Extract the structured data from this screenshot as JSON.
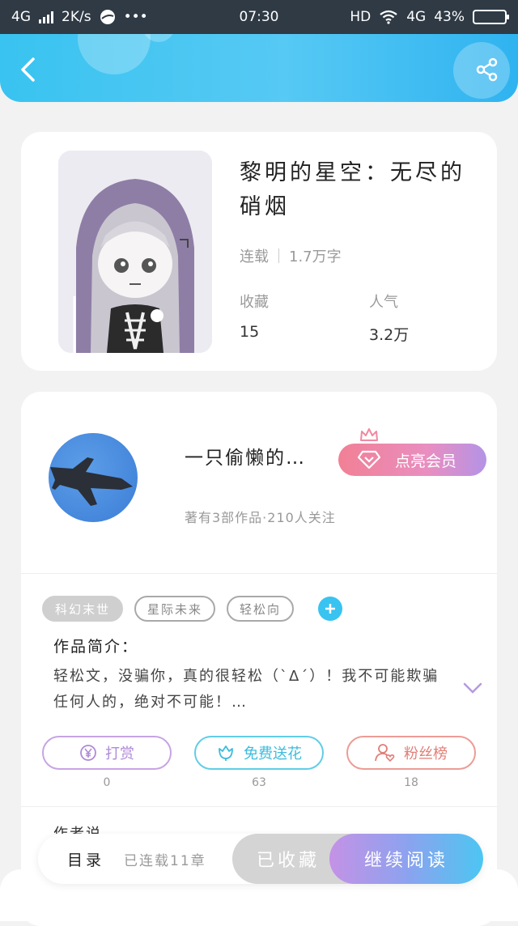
{
  "status_bar": {
    "network": "4G",
    "speed": "2K/s",
    "more": "•••",
    "time": "07:30",
    "hd": "HD",
    "network_right": "4G",
    "battery": "43%",
    "battery_level": 0.43,
    "battery_color": "#f3c12e"
  },
  "header": {
    "back_icon": "chevron-left-icon",
    "share_icon": "share-icon",
    "gradient": [
      "#39c3f0",
      "#2fb3f0"
    ]
  },
  "book": {
    "title": "黎明的星空：无尽的硝烟",
    "status": "连载",
    "word_count": "1.7万字",
    "favorites_label": "收藏",
    "favorites_value": "15",
    "popularity_label": "人气",
    "popularity_value": "3.2万"
  },
  "author": {
    "name": "一只偷懒的…",
    "vip_button": "点亮会员",
    "subtitle": "著有3部作品·210人关注"
  },
  "tags": [
    "科幻末世",
    "星际未来",
    "轻松向"
  ],
  "intro": {
    "label": "作品简介：",
    "text": "轻松文，没骗你，真的很轻松（`Δ´）！我不可能欺骗任何人的，绝对不可能！…"
  },
  "actions": [
    {
      "label": "打赏",
      "count": "0",
      "icon": "yen-coin-icon",
      "color": "#b08ad8"
    },
    {
      "label": "免费送花",
      "count": "63",
      "icon": "flower-icon",
      "color": "#3cbcdd"
    },
    {
      "label": "粉丝榜",
      "count": "18",
      "icon": "user-heart-icon",
      "color": "#e07f77"
    }
  ],
  "author_say_label": "作者说",
  "bottom_bar": {
    "toc": "目录",
    "chapters": "已连载11章",
    "collected": "已收藏",
    "continue": "继续阅读"
  }
}
